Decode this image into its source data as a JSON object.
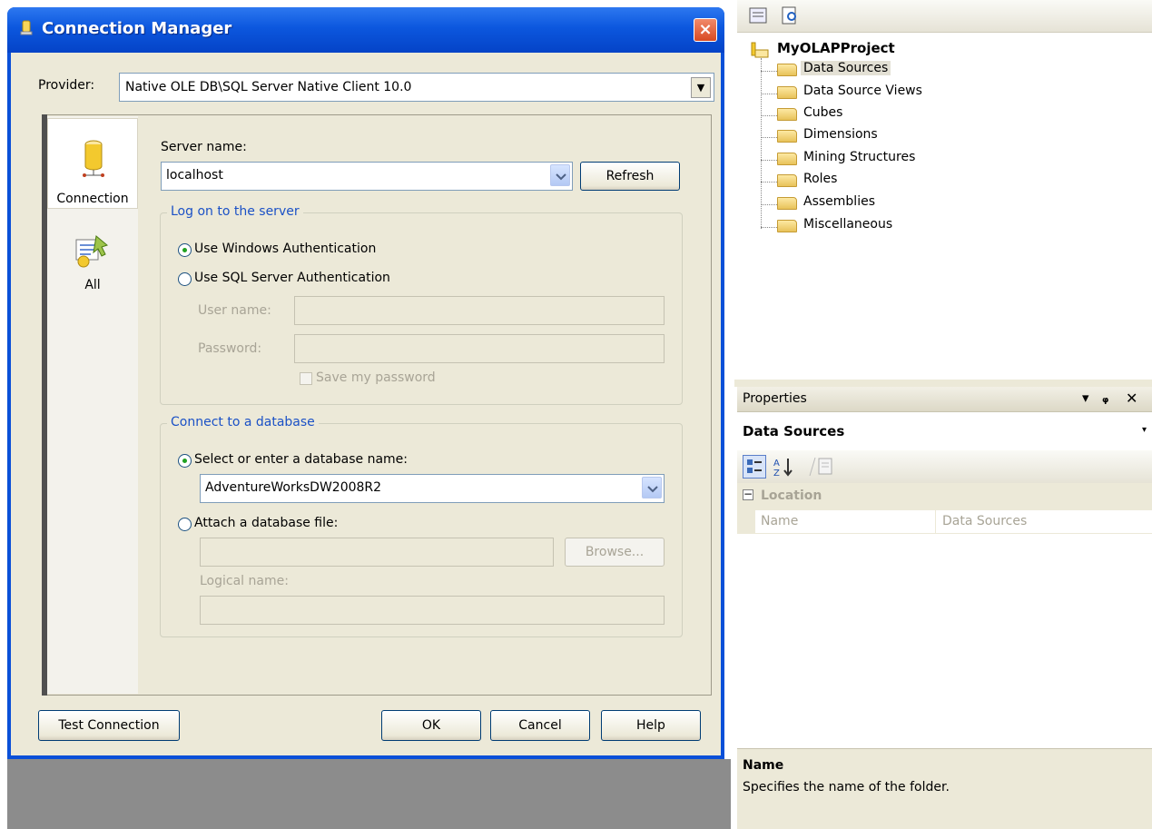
{
  "dialog": {
    "title": "Connection Manager",
    "close_glyph": "×",
    "provider_label": "Provider:",
    "provider_value": "Native OLE DB\\SQL Server Native Client 10.0",
    "nav": [
      {
        "label": "Connection",
        "icon": "database-icon"
      },
      {
        "label": "All",
        "icon": "properties-icon"
      }
    ],
    "server_name_label": "Server name:",
    "server_name_value": "localhost",
    "refresh_label": "Refresh",
    "logon_group": {
      "title": "Log on to the server",
      "windows_auth": "Use Windows Authentication",
      "sql_auth": "Use SQL Server Authentication",
      "username_label": "User name:",
      "password_label": "Password:",
      "save_password": "Save my password",
      "selected": "windows"
    },
    "database_group": {
      "title": "Connect to a database",
      "select_db_label": "Select or enter a database name:",
      "db_value": "AdventureWorksDW2008R2",
      "attach_label": "Attach a database file:",
      "browse_label": "Browse...",
      "logical_name_label": "Logical name:",
      "selected": "select"
    },
    "buttons": {
      "test_connection": "Test Connection",
      "ok": "OK",
      "cancel": "Cancel",
      "help": "Help"
    }
  },
  "solution_explorer": {
    "project": "MyOLAPProject",
    "folders": [
      "Data Sources",
      "Data Source Views",
      "Cubes",
      "Dimensions",
      "Mining Structures",
      "Roles",
      "Assemblies",
      "Miscellaneous"
    ],
    "selected_folder": "Data Sources"
  },
  "properties": {
    "header": "Properties",
    "header_controls": [
      "▾",
      "ᵩ",
      "✕"
    ],
    "object": "Data Sources",
    "category": "Location",
    "rows": [
      {
        "name": "Name",
        "value": "Data Sources"
      }
    ],
    "desc_title": "Name",
    "desc_text": "Specifies the name of the folder."
  },
  "colors": {
    "titlebar": "#0c57de",
    "dialog_bg": "#ece9d8",
    "group_title": "#1b51c6"
  }
}
